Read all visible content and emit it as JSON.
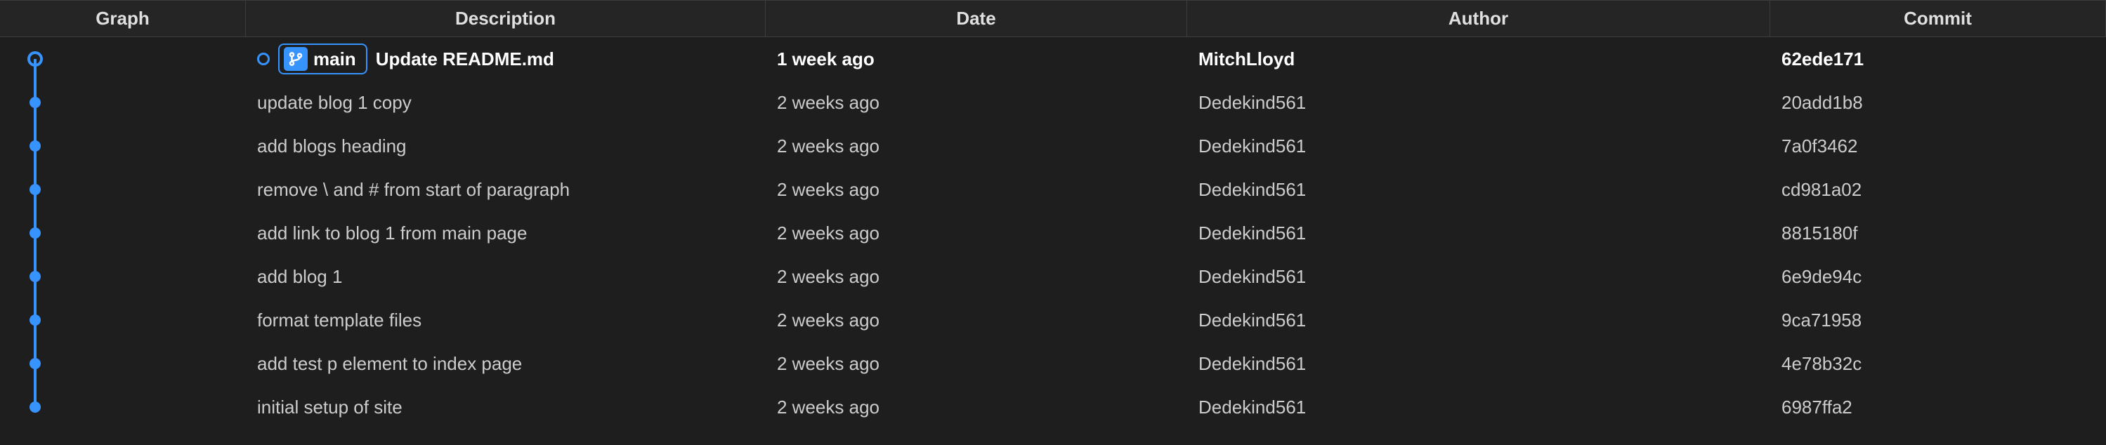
{
  "columns": {
    "graph": "Graph",
    "description": "Description",
    "date": "Date",
    "author": "Author",
    "commit": "Commit"
  },
  "headBranch": {
    "name": "main"
  },
  "commits": [
    {
      "description": "Update README.md",
      "date": "1 week ago",
      "author": "MitchLloyd",
      "hash": "62ede171",
      "isHead": true
    },
    {
      "description": "update blog 1 copy",
      "date": "2 weeks ago",
      "author": "Dedekind561",
      "hash": "20add1b8",
      "isHead": false
    },
    {
      "description": "add blogs heading",
      "date": "2 weeks ago",
      "author": "Dedekind561",
      "hash": "7a0f3462",
      "isHead": false
    },
    {
      "description": "remove \\ and # from start of paragraph",
      "date": "2 weeks ago",
      "author": "Dedekind561",
      "hash": "cd981a02",
      "isHead": false
    },
    {
      "description": "add link to blog 1 from main page",
      "date": "2 weeks ago",
      "author": "Dedekind561",
      "hash": "8815180f",
      "isHead": false
    },
    {
      "description": "add blog 1",
      "date": "2 weeks ago",
      "author": "Dedekind561",
      "hash": "6e9de94c",
      "isHead": false
    },
    {
      "description": "format template files",
      "date": "2 weeks ago",
      "author": "Dedekind561",
      "hash": "9ca71958",
      "isHead": false
    },
    {
      "description": "add test p element to index page",
      "date": "2 weeks ago",
      "author": "Dedekind561",
      "hash": "4e78b32c",
      "isHead": false
    },
    {
      "description": "initial setup of site",
      "date": "2 weeks ago",
      "author": "Dedekind561",
      "hash": "6987ffa2",
      "isHead": false
    }
  ]
}
